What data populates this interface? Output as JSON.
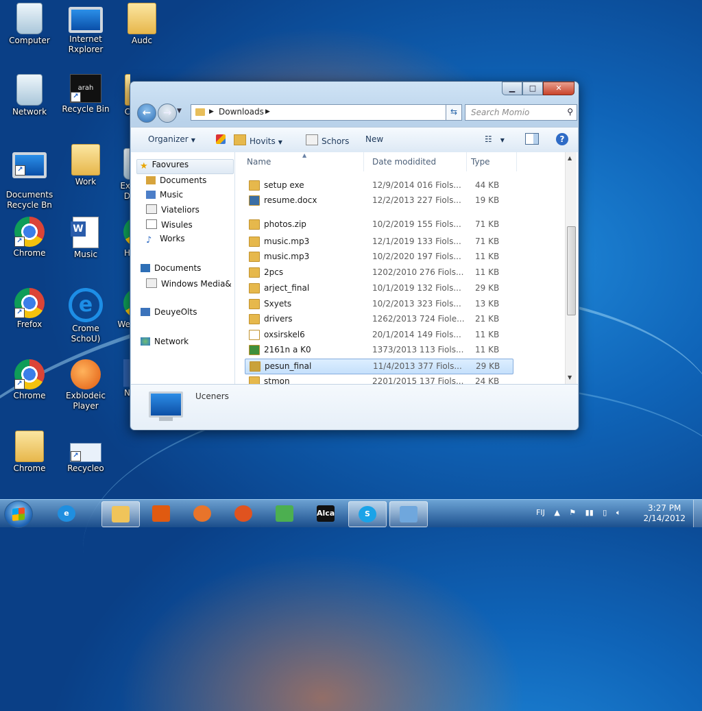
{
  "colors": {
    "accent": "#2e6fb6",
    "selection": "#c5e0fb",
    "taskbar": "#1e508c",
    "folder": "#e6b84c"
  },
  "desktop": {
    "icons": [
      {
        "label": "Computer",
        "icon": "recycle-bin-icon"
      },
      {
        "label": "Internet\nRxplorer",
        "icon": "computer-icon"
      },
      {
        "label": "Audc",
        "icon": "folder-icon"
      },
      {
        "label": "Network",
        "icon": "recycle-bin-icon"
      },
      {
        "label": "Recycle Bin",
        "icon": "app-icon"
      },
      {
        "label": "Documents\nRecycle Bn",
        "icon": "monitor-icon"
      },
      {
        "label": "Work",
        "icon": "folder-icon"
      },
      {
        "label": "Chrome",
        "icon": "chrome-icon"
      },
      {
        "label": "Music",
        "icon": "word-document-icon"
      },
      {
        "label": "Frefox",
        "icon": "chrome-icon"
      },
      {
        "label": "Crome\nSchoU)",
        "icon": "internet-explorer-icon"
      },
      {
        "label": "Chrome",
        "icon": "chrome-icon"
      },
      {
        "label": "Exblodeic\nPlayer",
        "icon": "media-player-icon"
      },
      {
        "label": "Chrome",
        "icon": "folder-icon"
      },
      {
        "label": "Recycleo",
        "icon": "network-icon"
      }
    ],
    "partial_labels": [
      "C",
      "Ex\nD",
      "H",
      "We",
      "N"
    ],
    "app_icon_text": "arah"
  },
  "window": {
    "address": {
      "path": "Downloads"
    },
    "search": {
      "placeholder": "Search Momio"
    },
    "toolbar": {
      "organize": "Organizer",
      "hovits": "Hovits",
      "schors": "Schors",
      "new": "New"
    },
    "nav": {
      "favorites": "Faovures",
      "items": [
        "Documents",
        "Music",
        "Viateliors",
        "Wisules",
        "Works"
      ],
      "documents": "Documents",
      "windows_media": "Windows Media&",
      "devices": "DeuyeOlts",
      "network": "Network"
    },
    "columns": {
      "name": "Name",
      "date": "Date modidited",
      "type": "Type"
    },
    "files": [
      {
        "name": "setup exe",
        "date": "12/9/2014 016 Fiols...",
        "size": "44 KB",
        "icon": "folder-icon"
      },
      {
        "name": "resume.docx",
        "date": "12/2/2013 227 Fiols...",
        "size": "19 KB",
        "icon": "media-file-icon"
      },
      {
        "name": "photos.zip",
        "date": "10/2/2019 155 Fiols...",
        "size": "71 KB",
        "icon": "folder-icon"
      },
      {
        "name": "music.mp3",
        "date": "12/1/2019 133 Fiols...",
        "size": "71 KB",
        "icon": "folder-icon"
      },
      {
        "name": "music.mp3",
        "date": "10/2/2020 197 Fiols...",
        "size": "11 KB",
        "icon": "folder-icon"
      },
      {
        "name": "2pcs",
        "date": "1202/2010 276 Fiols...",
        "size": "11 KB",
        "icon": "folder-icon"
      },
      {
        "name": "arject_final",
        "date": "10/1/2019 132 Fiols...",
        "size": "29 KB",
        "icon": "folder-icon"
      },
      {
        "name": "Sxyets",
        "date": "10/2/2013 323 Fiols...",
        "size": "13 KB",
        "icon": "folder-icon"
      },
      {
        "name": "drivers",
        "date": "1262/2013 724 Fiole...",
        "size": "21 KB",
        "icon": "folder-icon"
      },
      {
        "name": "oxsirskel6",
        "date": "20/1/2014 149 Fiols...",
        "size": "11 KB",
        "icon": "text-file-icon"
      },
      {
        "name": "2161n a K0",
        "date": "1373/2013 113 Fiols...",
        "size": "11 KB",
        "icon": "app-file-icon"
      },
      {
        "name": "pesun_final",
        "date": "11/4/2013 377 Fiols...",
        "size": "29 KB",
        "icon": "script-file-icon",
        "selected": true
      },
      {
        "name": "stmon",
        "date": "2201/2015 137 Fiols...",
        "size": "24 KB",
        "icon": "folder-icon"
      }
    ],
    "details": {
      "label": "Uceners"
    }
  },
  "taskbar": {
    "apps": [
      {
        "icon": "internet-explorer-icon",
        "glyph": "e"
      },
      {
        "icon": "file-explorer-icon",
        "glyph": ""
      },
      {
        "icon": "media-player-icon",
        "glyph": ""
      },
      {
        "icon": "firefox-icon",
        "glyph": ""
      },
      {
        "icon": "firefox-icon",
        "glyph": ""
      },
      {
        "icon": "chat-icon",
        "glyph": ""
      },
      {
        "icon": "app-icon",
        "glyph": "Alca"
      },
      {
        "icon": "skype-icon",
        "glyph": "S"
      },
      {
        "icon": "remote-desktop-icon",
        "glyph": ""
      }
    ],
    "lang": "FIJ",
    "time": "3:27 PM",
    "date": "2/14/2012"
  }
}
